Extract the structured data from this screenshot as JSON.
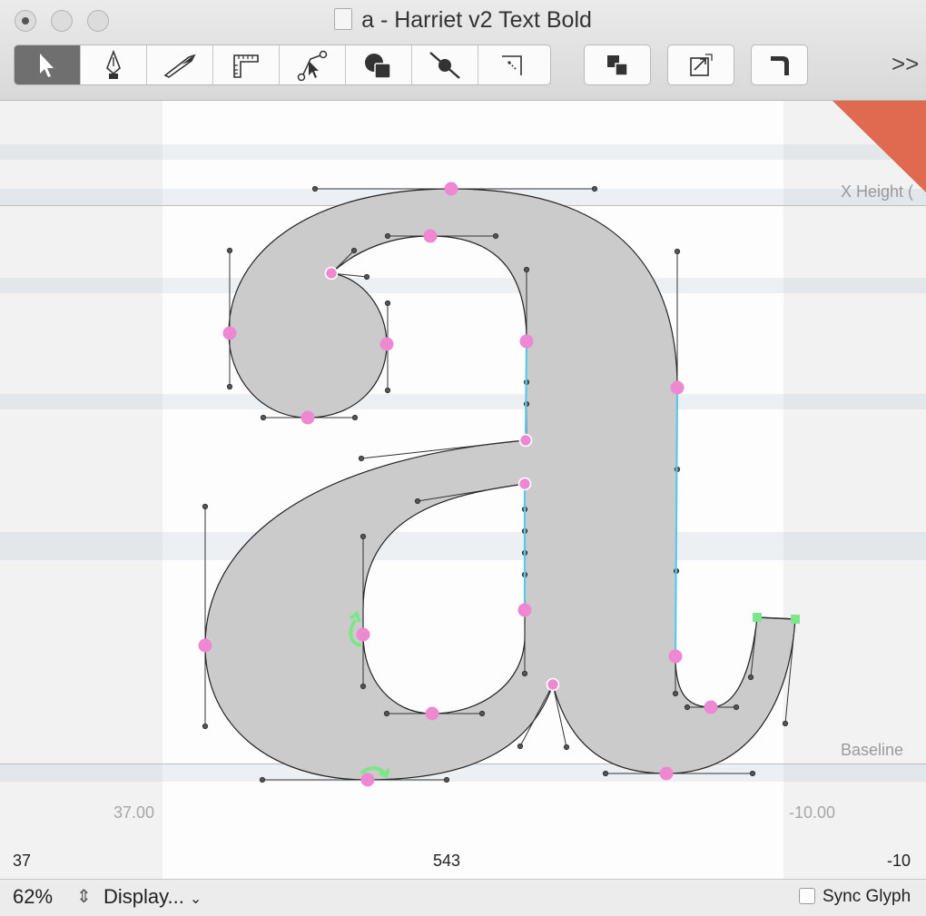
{
  "window": {
    "title": "a - Harriet v2 Text Bold"
  },
  "toolbar": {
    "tools": [
      {
        "name": "pointer-tool",
        "icon": "arrow-pointer-icon",
        "active": true
      },
      {
        "name": "pen-tool",
        "icon": "pen-nib-icon",
        "active": false
      },
      {
        "name": "knife-tool",
        "icon": "knife-icon",
        "active": false
      },
      {
        "name": "measure-tool",
        "icon": "ruler-icon",
        "active": false
      },
      {
        "name": "node-select-tool",
        "icon": "node-pointer-icon",
        "active": false
      },
      {
        "name": "shapes-tool",
        "icon": "shapes-icon",
        "active": false
      },
      {
        "name": "cut-tool",
        "icon": "line-cut-icon",
        "active": false
      },
      {
        "name": "corner-tool",
        "icon": "corner-icon",
        "active": false
      }
    ],
    "actions": [
      {
        "name": "overlap-button",
        "icon": "overlap-squares-icon"
      },
      {
        "name": "transform-button",
        "icon": "transform-icon"
      },
      {
        "name": "round-corner-button",
        "icon": "round-corner-icon"
      }
    ],
    "overflow_label": ">>"
  },
  "metrics": {
    "x_height_label": "X Height (",
    "baseline_label": "Baseline",
    "left_sidebearing": "37.00",
    "right_sidebearing": "-10.00",
    "left_value": "37",
    "width_value": "543",
    "right_value": "-10"
  },
  "colors": {
    "glyph_fill": "#cbcbcb",
    "node_pink": "#ee88d2",
    "green_marker": "#7ee68a",
    "corner_flag": "#e06a50",
    "selected_segment": "#5ac8ea"
  },
  "statusbar": {
    "zoom": "62%",
    "stepper_icon": "up-down-arrows-icon",
    "display_menu": "Display...",
    "sync_label": "Sync Glyph",
    "sync_checked": false
  }
}
